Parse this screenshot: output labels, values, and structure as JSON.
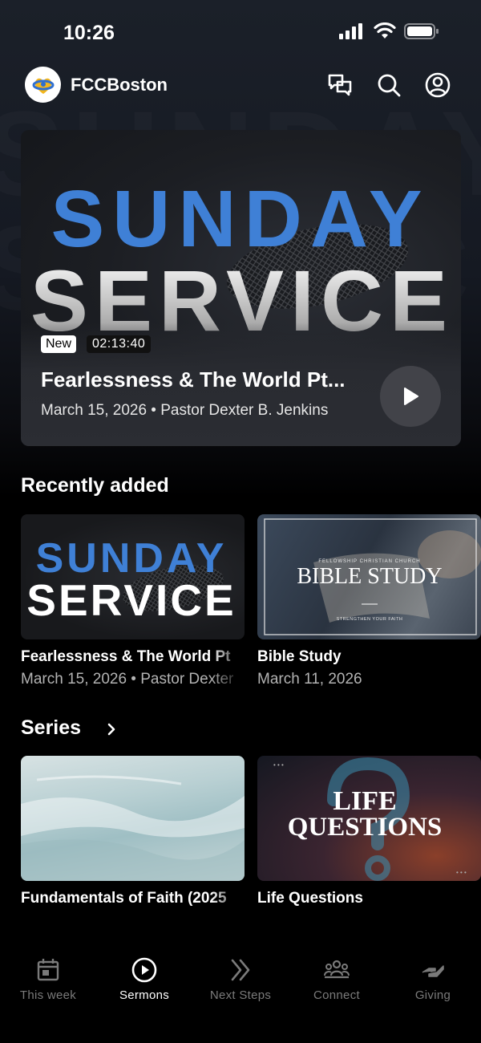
{
  "status": {
    "time": "10:26"
  },
  "header": {
    "app_name": "FCCBoston"
  },
  "hero": {
    "art_line1": "SUNDAY",
    "art_line2": "SERVICE",
    "badge_new": "New",
    "duration": "02:13:40",
    "title": "Fearlessness & The World Pt...",
    "meta": "March 15, 2026 • Pastor Dexter B. Jenkins"
  },
  "recent": {
    "title": "Recently added",
    "items": [
      {
        "art_line1": "SUNDAY",
        "art_line2": "SERVICE",
        "title": "Fearlessness & The World Pt",
        "meta": "March 15, 2026 • Pastor Dexter"
      },
      {
        "art_small": "FELLOWSHIP CHRISTIAN CHURCH",
        "art_title": "BIBLE STUDY",
        "art_sub": "STRENGTHEN YOUR FAITH",
        "title": "Bible Study",
        "meta": "March 11, 2026"
      }
    ]
  },
  "series": {
    "title": "Series",
    "items": [
      {
        "title": "Fundamentals of Faith (2025"
      },
      {
        "art_line1": "LIFE",
        "art_line2": "QUESTIONS",
        "title": "Life Questions"
      }
    ]
  },
  "tabs": [
    {
      "label": "This week",
      "icon": "calendar-icon"
    },
    {
      "label": "Sermons",
      "icon": "play-circle-icon",
      "active": true
    },
    {
      "label": "Next Steps",
      "icon": "double-chevron-icon"
    },
    {
      "label": "Connect",
      "icon": "people-icon"
    },
    {
      "label": "Giving",
      "icon": "hand-icon"
    }
  ],
  "colors": {
    "accent_blue": "#3f80d6",
    "background": "#000000"
  }
}
